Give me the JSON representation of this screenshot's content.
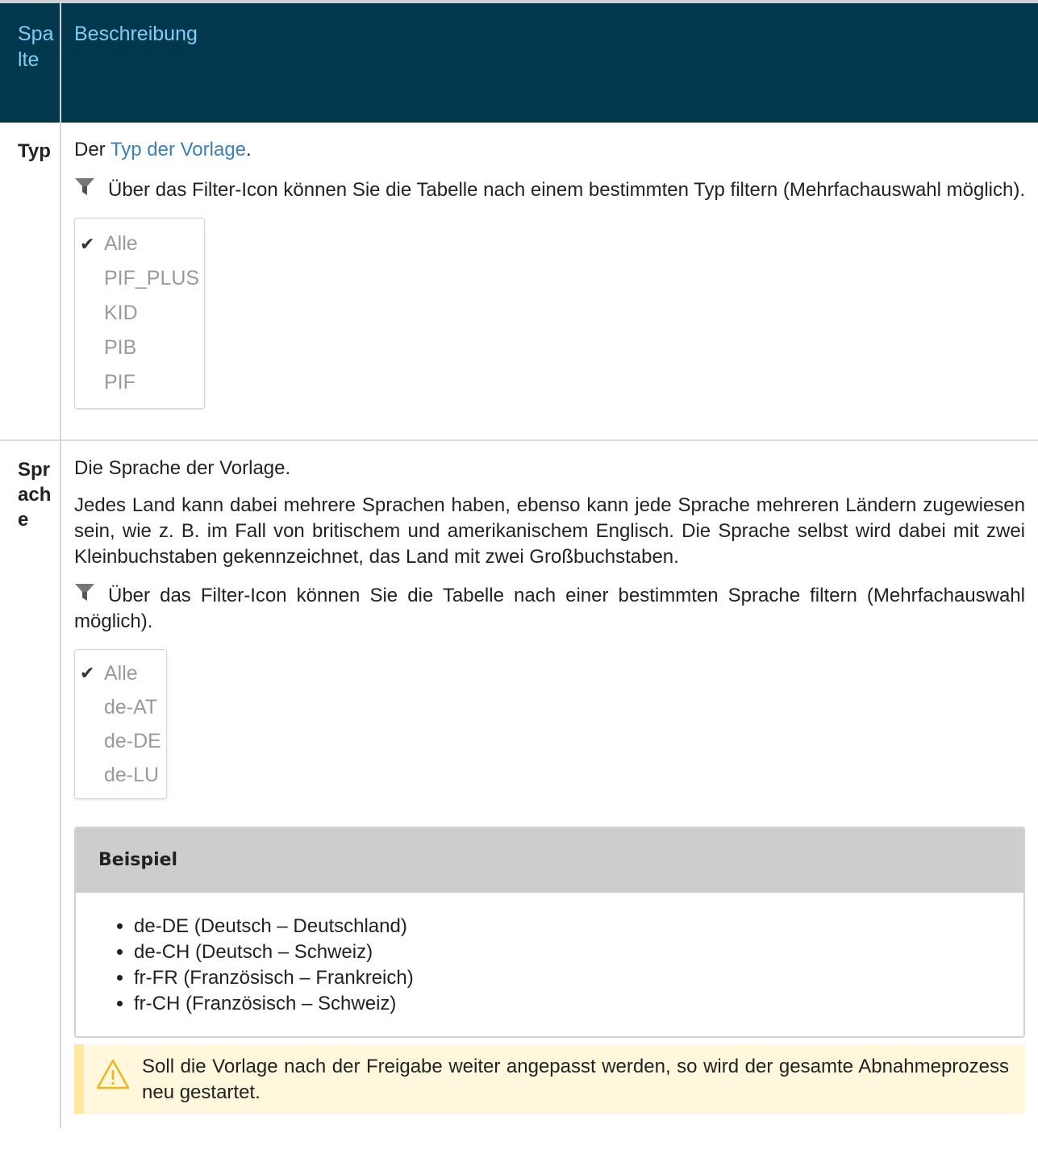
{
  "header": {
    "col1": "Spalte",
    "col2": "Beschreibung"
  },
  "rows": [
    {
      "name": "Typ",
      "intro_prefix": "Der ",
      "intro_link": "Typ der Vorlage",
      "intro_suffix": ".",
      "filter_text": "Über das Filter-Icon können Sie die Tabelle nach einem bestimmten Typ filtern (Mehrfachauswahl möglich).",
      "filter_options": [
        "Alle",
        "PIF_PLUS",
        "KID",
        "PIB",
        "PIF"
      ]
    },
    {
      "name": "Sprache",
      "intro": "Die Sprache der Vorlage.",
      "para": "Jedes Land kann dabei mehrere Sprachen haben, ebenso kann jede Sprache mehreren Ländern zugewiesen sein, wie z. B. im Fall von britischem und amerikanischem Englisch. Die Sprache selbst wird dabei mit zwei Kleinbuchstaben gekennzeichnet, das Land mit zwei Großbuchstaben.",
      "filter_text": "Über das Filter-Icon können Sie die Tabelle nach einer bestimmten Sprache filtern (Mehrfachauswahl möglich).",
      "filter_options": [
        "Alle",
        "de-AT",
        "de-DE",
        "de-LU"
      ],
      "example": {
        "title": "Beispiel",
        "items": [
          "de-DE (Deutsch – Deutschland)",
          "de-CH (Deutsch – Schweiz)",
          "fr-FR (Französisch – Frankreich)",
          "fr-CH (Französisch – Schweiz)"
        ]
      },
      "warning": "Soll die Vorlage nach der Freigabe weiter angepasst werden, so wird der gesamte Abnahmeprozess neu gestartet."
    }
  ],
  "colors": {
    "header_bg": "#02384e",
    "header_text": "#7cd0f4",
    "link": "#3a80b9",
    "warning_bg": "#fff8dd"
  },
  "icons": [
    "filter-icon",
    "check-icon",
    "warning-icon"
  ]
}
